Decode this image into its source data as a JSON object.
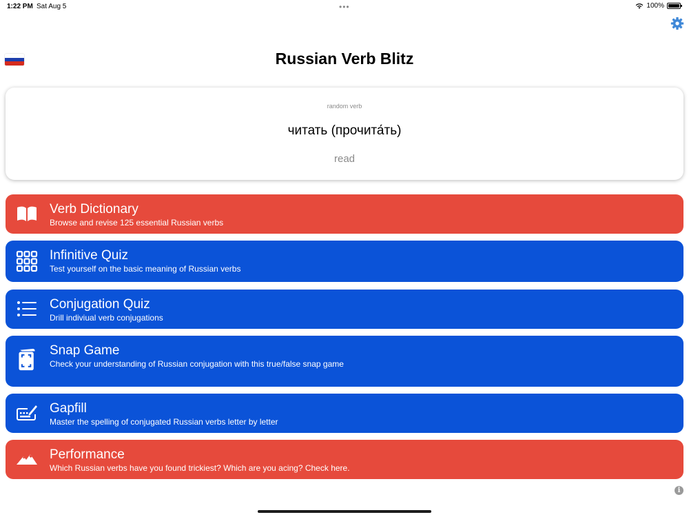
{
  "status_bar": {
    "time": "1:22 PM",
    "date": "Sat Aug 5",
    "battery": "100%",
    "icons": [
      "wifi-icon",
      "battery-icon"
    ]
  },
  "header": {
    "title": "Russian Verb Blitz",
    "flag": "russian-flag-icon",
    "settings_icon": "gear-icon",
    "colors": {
      "gear": "#3f88d8"
    }
  },
  "random_verb": {
    "label": "random verb",
    "verb": "читать (прочита́ть)",
    "meaning": "read"
  },
  "menu": [
    {
      "title": "Verb Dictionary",
      "subtitle": "Browse and revise 125 essential Russian verbs",
      "icon": "book-icon",
      "color": "#e64a3c"
    },
    {
      "title": "Infinitive Quiz",
      "subtitle": "Test yourself on the basic meaning of Russian verbs",
      "icon": "grid-icon",
      "color": "#0b53d8"
    },
    {
      "title": "Conjugation Quiz",
      "subtitle": "Drill indiviual verb conjugations",
      "icon": "list-icon",
      "color": "#0b53d8"
    },
    {
      "title": "Snap Game",
      "subtitle": "Check your understanding of Russian conjugation with this true/false snap game",
      "icon": "cards-icon",
      "color": "#0b53d8"
    },
    {
      "title": "Gapfill",
      "subtitle": "Master the spelling of conjugated Russian verbs letter by letter",
      "icon": "keyboard-pencil-icon",
      "color": "#0b53d8"
    },
    {
      "title": "Performance",
      "subtitle": "Which Russian verbs have you found trickiest? Which are you acing? Check here.",
      "icon": "mountains-icon",
      "color": "#e64a3c"
    }
  ],
  "footer": {
    "info_icon": "info-icon",
    "info_glyph": "i"
  }
}
